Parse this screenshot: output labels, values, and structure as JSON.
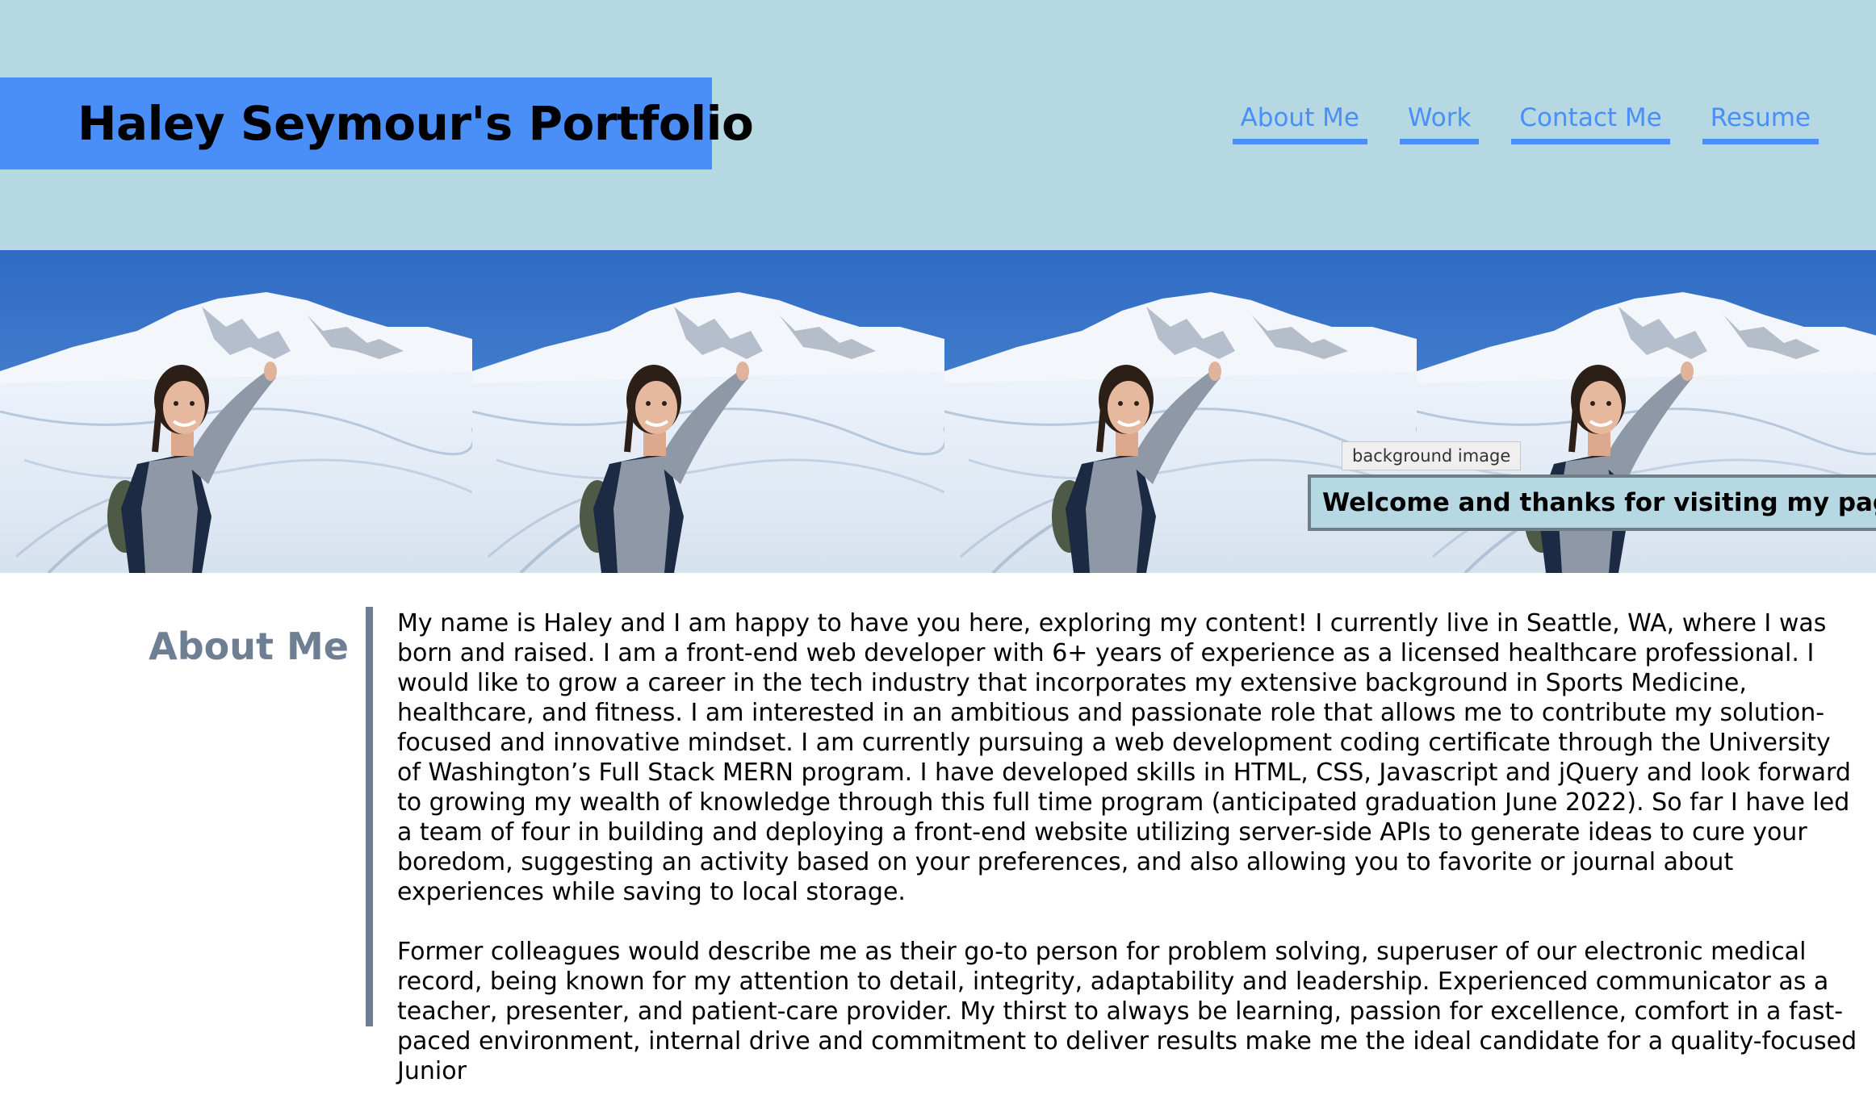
{
  "header": {
    "title": "Haley Seymour's Portfolio",
    "nav": [
      "About Me",
      "Work",
      "Contact Me",
      "Resume"
    ]
  },
  "hero": {
    "tooltip": "background image",
    "welcome": "Welcome and thanks for visiting my page!"
  },
  "about": {
    "title": "About Me",
    "paragraphs": [
      "My name is Haley and I am happy to have you here, exploring my content! I currently live in Seattle, WA, where I was born and raised. I am a front-end web developer with 6+ years of experience as a licensed healthcare professional. I would like to grow a career in the tech industry that incorporates my extensive background in Sports Medicine, healthcare, and fitness. I am interested in an ambitious and passionate role that allows me to contribute my solution-focused and innovative mindset. I am currently pursuing a web development coding certificate through the University of Washington’s Full Stack MERN program. I have developed skills in HTML, CSS, Javascript and jQuery and look forward to growing my wealth of knowledge through this full time program (anticipated graduation June 2022). So far I have led a team of four in building and deploying a front-end website utilizing server-side APIs to generate ideas to cure your boredom, suggesting an activity based on your preferences, and also allowing you to favorite or journal about experiences while saving to local storage.",
      "Former colleagues would describe me as their go-to person for problem solving, superuser of our electronic medical record, being known for my attention to detail, integrity, adaptability and leadership. Experienced communicator as a teacher, presenter, and patient-care provider. My thirst to always be learning, passion for excellence, comfort in a fast-paced environment, internal drive and commitment to deliver results make me the ideal candidate for a quality-focused Junior"
    ]
  },
  "colors": {
    "header_bg": "#b5d8e3",
    "brand_bg": "#4a8ff8",
    "accent": "#4a8ff8",
    "about_heading": "#6e7e93"
  }
}
